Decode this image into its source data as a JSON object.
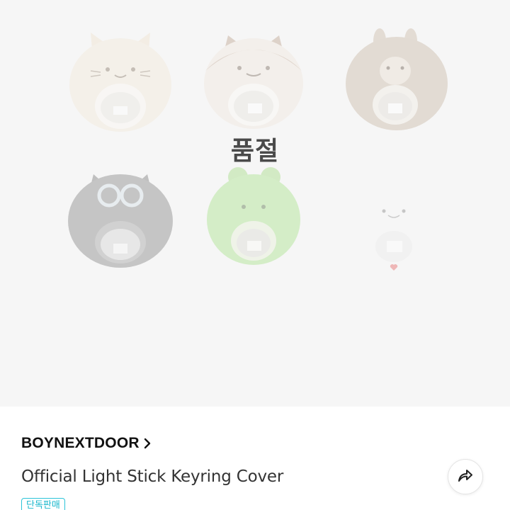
{
  "product": {
    "sold_out_label": "품절",
    "brand": "BOYNEXTDOOR",
    "title": "Official Light Stick Keyring Cover",
    "badge": "단독판매",
    "images": [
      {
        "name": "cream-cat-cover",
        "color": "#efe6d7"
      },
      {
        "name": "hamster-cover",
        "color": "#e9ded3"
      },
      {
        "name": "brown-bunny-cover",
        "color": "#c9b8a7"
      },
      {
        "name": "gray-owl-cover",
        "color": "#8a8a8a"
      },
      {
        "name": "green-frog-cover",
        "color": "#a9e08d"
      },
      {
        "name": "white-ghost-cover",
        "color": "#f1f1f1"
      }
    ]
  },
  "icons": {
    "brand_chevron": "chevron-right-icon",
    "share": "share-arrow-icon"
  },
  "colors": {
    "badge_accent": "#19b7cc",
    "hero_bg": "#f6f6f6"
  }
}
